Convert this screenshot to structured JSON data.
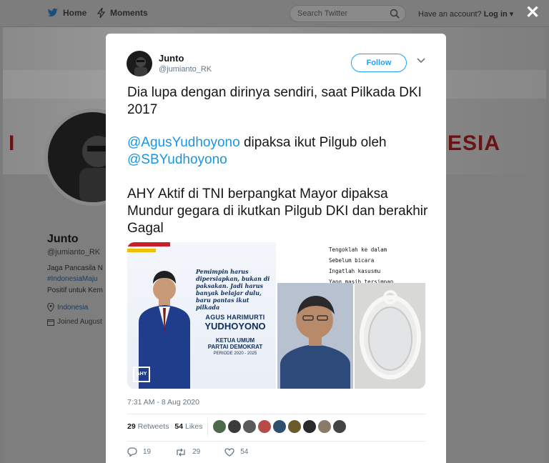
{
  "nav": {
    "home_label": "Home",
    "moments_label": "Moments",
    "search_placeholder": "Search Twitter",
    "account_prompt": "Have an account?",
    "login_label": "Log in",
    "close_symbol": "✕"
  },
  "banner": {
    "left_text": "I",
    "right_text": "ESIA"
  },
  "profile": {
    "name": "Junto",
    "handle": "@jumianto_RK",
    "bio_line1": "Jaga Pancasila N",
    "bio_line2": "#IndonesiaMaju",
    "bio_line3": "Positif untuk Kem",
    "location": "Indonesia",
    "joined": "Joined August"
  },
  "tweet": {
    "author_name": "Junto",
    "author_handle": "@jumianto_RK",
    "follow_label": "Follow",
    "text1": "Dia lupa dengan dirinya sendiri, saat Pilkada DKI 2017",
    "mention1": "@AgusYudhoyono",
    "text2_mid": " dipaksa ikut Pilgub oleh ",
    "mention2": "@SBYudhoyono",
    "text3": "AHY Aktif di TNI berpangkat Mayor dipaksa Mundur gegara di ikutkan Pilgub DKI dan berakhir Gagal",
    "timestamp": "7:31 AM - 8 Aug 2020",
    "retweets_count": "29",
    "retweets_label": "Retweets",
    "likes_count": "54",
    "likes_label": "Likes",
    "reply_count": "19",
    "retweet_action_count": "29",
    "like_action_count": "54"
  },
  "media": {
    "quote": "Pemimpin harus dipersiapkan, bukan di paksakan. Jadi harus banyak belajar dulu, baru pantas ikut pilkada",
    "candidate_first": "AGUS HARIMURTI",
    "candidate_last": "YUDHOYONO",
    "role_line1": "KETUA UMUM",
    "role_line2": "PARTAI DEMOKRAT",
    "period": "PERIODE 2020 - 2025",
    "logo": "AHY",
    "poem": "Tengoklah ke dalam\nSebelum bicara\nIngatlah kasusmu\nYang masih tersimpan"
  },
  "colors": {
    "twitter_blue": "#1da1f2",
    "mention_blue": "#1b95e0",
    "overlay_gray": "#7b7b7b"
  },
  "icons": {
    "home": "bird-icon",
    "moments": "bolt-icon",
    "search": "search-icon",
    "close": "close-icon",
    "reply": "reply-icon",
    "retweet": "retweet-icon",
    "like": "heart-icon"
  }
}
